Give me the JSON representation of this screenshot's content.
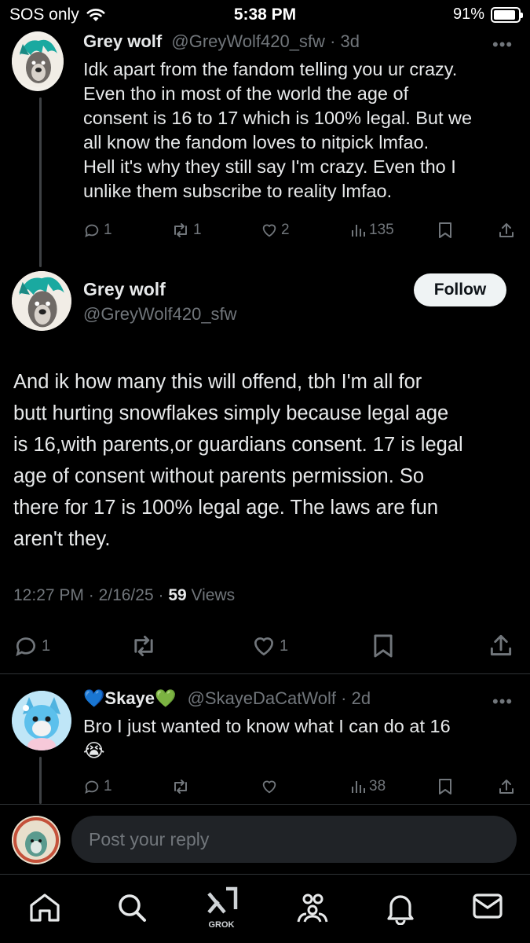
{
  "status_bar": {
    "carrier": "SOS only",
    "time": "5:38 PM",
    "battery_percent_label": "91%",
    "battery_level": 0.91
  },
  "parent_tweet": {
    "author_name": "Grey wolf",
    "handle": "@GreyWolf420_sfw",
    "age": "· 3d",
    "more_icon": "more-horizontal-icon",
    "text_lines": [
      "Idk apart from the fandom telling you ur crazy.",
      "Even tho in most of the world the age of",
      "consent is 16 to 17 which is 100% legal. But we",
      "all know the fandom loves to nitpick lmfao.",
      "Hell it's why they still say I'm crazy. Even tho I",
      "unlike them subscribe to reality lmfao."
    ],
    "replies": "1",
    "reposts": "1",
    "likes": "2",
    "views": "135"
  },
  "main_tweet": {
    "author_name": "Grey wolf",
    "handle": "@GreyWolf420_sfw",
    "follow_label": "Follow",
    "text_lines": [
      "And ik how many this will offend, tbh I'm all for",
      "butt hurting snowflakes simply because legal age",
      "is 16,with parents,or guardians consent. 17 is legal",
      "age of consent without parents permission. So",
      "there for 17 is 100% legal age. The laws are fun",
      "aren't they."
    ],
    "time": "12:27 PM",
    "date": "2/16/25",
    "views_count": "59",
    "views_label": "Views",
    "replies": "1",
    "likes": "1"
  },
  "reply_tweet": {
    "author_prefix_emoji": "💙",
    "author_name": "Skaye",
    "author_suffix_emoji": "💚",
    "handle": "@SkayeDaCatWolf",
    "age": "· 2d",
    "text": "Bro I just wanted to know what I can do at 16",
    "emoji": "😭",
    "replies": "1",
    "views": "38"
  },
  "composer": {
    "placeholder": "Post your reply"
  },
  "tab_bar": {
    "grok_label": "GROK",
    "icons": [
      "home-icon",
      "search-icon",
      "grok-icon",
      "communities-icon",
      "notifications-icon",
      "messages-icon"
    ]
  },
  "colors": {
    "background": "#000000",
    "text": "#e7e9ea",
    "muted": "#71767b",
    "divider": "#2f3336",
    "follow_bg": "#eff3f4"
  }
}
